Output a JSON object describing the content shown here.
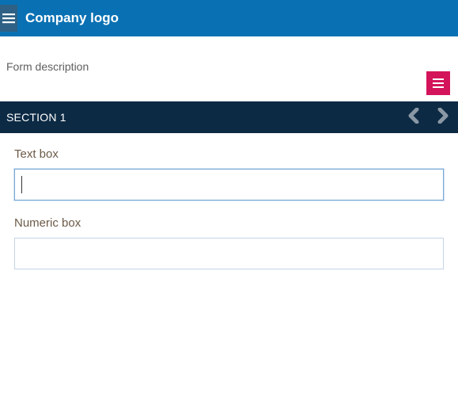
{
  "header": {
    "logo_text": "Company logo"
  },
  "form": {
    "description": "Form description"
  },
  "section": {
    "title": "SECTION 1"
  },
  "fields": {
    "textbox": {
      "label": "Text box",
      "value": ""
    },
    "numeric": {
      "label": "Numeric box",
      "value": ""
    }
  }
}
